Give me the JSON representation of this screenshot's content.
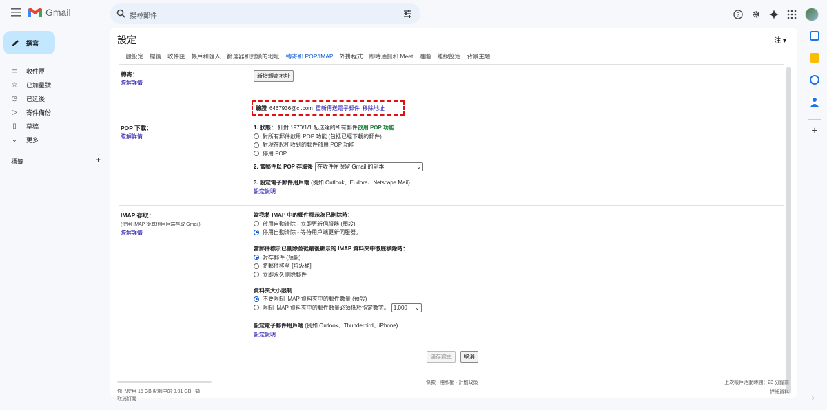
{
  "app": {
    "name": "Gmail"
  },
  "search": {
    "placeholder": "搜尋郵件"
  },
  "compose": {
    "label": "撰寫"
  },
  "nav": [
    {
      "label": "收件匣",
      "icon": "inbox-icon",
      "glyph": "▭"
    },
    {
      "label": "已加星號",
      "icon": "star-icon",
      "glyph": "☆"
    },
    {
      "label": "已延後",
      "icon": "clock-icon",
      "glyph": "◷"
    },
    {
      "label": "寄件備份",
      "icon": "send-icon",
      "glyph": "▷"
    },
    {
      "label": "草稿",
      "icon": "draft-icon",
      "glyph": "▯"
    },
    {
      "label": "更多",
      "icon": "chevron-down-icon",
      "glyph": "⌄"
    }
  ],
  "labels": {
    "title": "標籤",
    "add": "+"
  },
  "settings": {
    "title": "設定",
    "lang": "注",
    "tabs": [
      "一般設定",
      "標籤",
      "收件匣",
      "帳戶和匯入",
      "篩選器和封鎖的地址",
      "轉寄和 POP/IMAP",
      "外掛程式",
      "即時通訊和 Meet",
      "進階",
      "離線設定",
      "背景主題"
    ],
    "active_tab": 5,
    "forwarding": {
      "title": "轉寄：",
      "learn_more": "瞭解詳情",
      "add_button": "新增轉寄地址",
      "verify_label": "驗證",
      "verify_email": "6467936@c  .com",
      "resend": "重新傳送電子郵件",
      "remove": "移除地址"
    },
    "pop": {
      "title": "POP 下載：",
      "learn_more": "瞭解詳情",
      "status_prefix": "1. 狀態：",
      "status_text": "針對 1970/1/1 起送達的所有郵件",
      "status_enabled": "啟用 POP 功能",
      "options": [
        "對所有郵件啟用 POP 功能 (包括已經下載的郵件)",
        "對現在起所收到的郵件啟用 POP 功能",
        "停用 POP"
      ],
      "selected": -1,
      "step2": "2. 當郵件以 POP 存取後",
      "step2_select": "在收件匣保留 Gmail 的副本",
      "step3": "3. 設定電子郵件用戶端",
      "step3_note": "(例如 Outlook、Eudora、Netscape Mail)",
      "step3_link": "設定說明"
    },
    "imap": {
      "title": "IMAP 存取：",
      "subtitle": "(使用 IMAP 從其他用戶端存取 Gmail)",
      "learn_more": "瞭解詳情",
      "deleted_title": "當我將 IMAP 中的郵件標示為已刪除時：",
      "deleted_options": [
        "啟用自動清除 - 立即更新伺服器 (預設)",
        "停用自動清除 - 等待用戶端更新伺服器。"
      ],
      "deleted_selected": 1,
      "expunge_title": "當郵件標示已刪除並從最後顯示的 IMAP 資料夾中徹底移除時：",
      "expunge_options": [
        "封存郵件 (預設)",
        "將郵件移至 [垃圾桶]",
        "立即永久刪除郵件"
      ],
      "expunge_selected": 0,
      "folder_title": "資料夾大小限制",
      "folder_options": [
        "不要限制 IMAP 資料夾中的郵件數量 (預設)",
        "限制 IMAP 資料夾中的郵件數量必須低於指定數字。"
      ],
      "folder_selected": 0,
      "folder_limit": "1,000",
      "client_title": "設定電子郵件用戶端",
      "client_note": "(例如 Outlook、Thunderbird、iPhone)",
      "client_link": "設定說明"
    },
    "save_button": "儲存變更",
    "cancel_button": "取消"
  },
  "footer": {
    "storage": "你已使用 15 GB 配額中的 0.01 GB",
    "manage": "取消訂閱",
    "links": "條款 · 隱私權 · 計劃政策",
    "activity": "上次帳戶活動時間：23 分鐘前",
    "details": "詳細資料"
  }
}
